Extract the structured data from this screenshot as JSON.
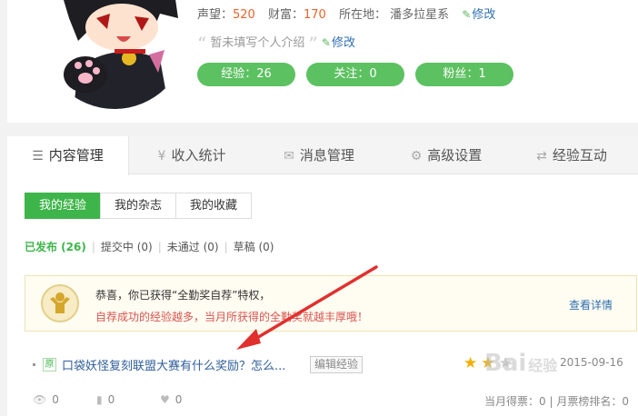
{
  "profile": {
    "reputation_label": "声望：",
    "reputation_value": "520",
    "wealth_label": "财富：",
    "wealth_value": "170",
    "location_label": "所在地：",
    "location_value": "潘多拉星系",
    "edit_label": "修改",
    "intro_placeholder": "暂未填写个人介绍",
    "intro_edit_label": "修改",
    "pills": [
      "经验：26",
      "关注：0",
      "粉丝：1"
    ]
  },
  "tabs": [
    {
      "label": "内容管理",
      "icon": "list-icon",
      "active": true
    },
    {
      "label": "收入统计",
      "icon": "yen-icon",
      "active": false
    },
    {
      "label": "消息管理",
      "icon": "mail-icon",
      "active": false
    },
    {
      "label": "高级设置",
      "icon": "gear-icon",
      "active": false
    },
    {
      "label": "经验互动",
      "icon": "exchange-icon",
      "active": false
    }
  ],
  "subtabs": [
    {
      "label": "我的经验",
      "active": true
    },
    {
      "label": "我的杂志",
      "active": false
    },
    {
      "label": "我的收藏",
      "active": false
    }
  ],
  "filters": [
    {
      "label": "已发布 (26)",
      "active": true
    },
    {
      "label": "提交中 (0)",
      "active": false
    },
    {
      "label": "未通过 (0)",
      "active": false
    },
    {
      "label": "草稿 (0)",
      "active": false
    }
  ],
  "notice": {
    "line1": "恭喜，你已获得“全勤奖自荐”特权，",
    "line2": "自荐成功的经验越多，当月所获得的全勤奖就越丰厚哦！",
    "link": "查看详情"
  },
  "item": {
    "badge": "原",
    "title": "口袋妖怪复刻联盟大赛有什么奖励？怎么...",
    "edit_button": "编辑经验",
    "stars_on": 2,
    "stars_total": 3,
    "date": "2015-09-16",
    "views": "0",
    "votes": "0",
    "likes": "0",
    "monthly": "当月得票：0 | 月票榜排名：0"
  },
  "watermark": {
    "text": "Bai",
    "suffix": "经验"
  },
  "colors": {
    "accent_green": "#3eb54a",
    "pill_green": "#5cc160",
    "link_blue": "#2f6fb0",
    "number_orange": "#e5642b",
    "arrow_red": "#e0302e",
    "star_gold": "#f1b000"
  }
}
